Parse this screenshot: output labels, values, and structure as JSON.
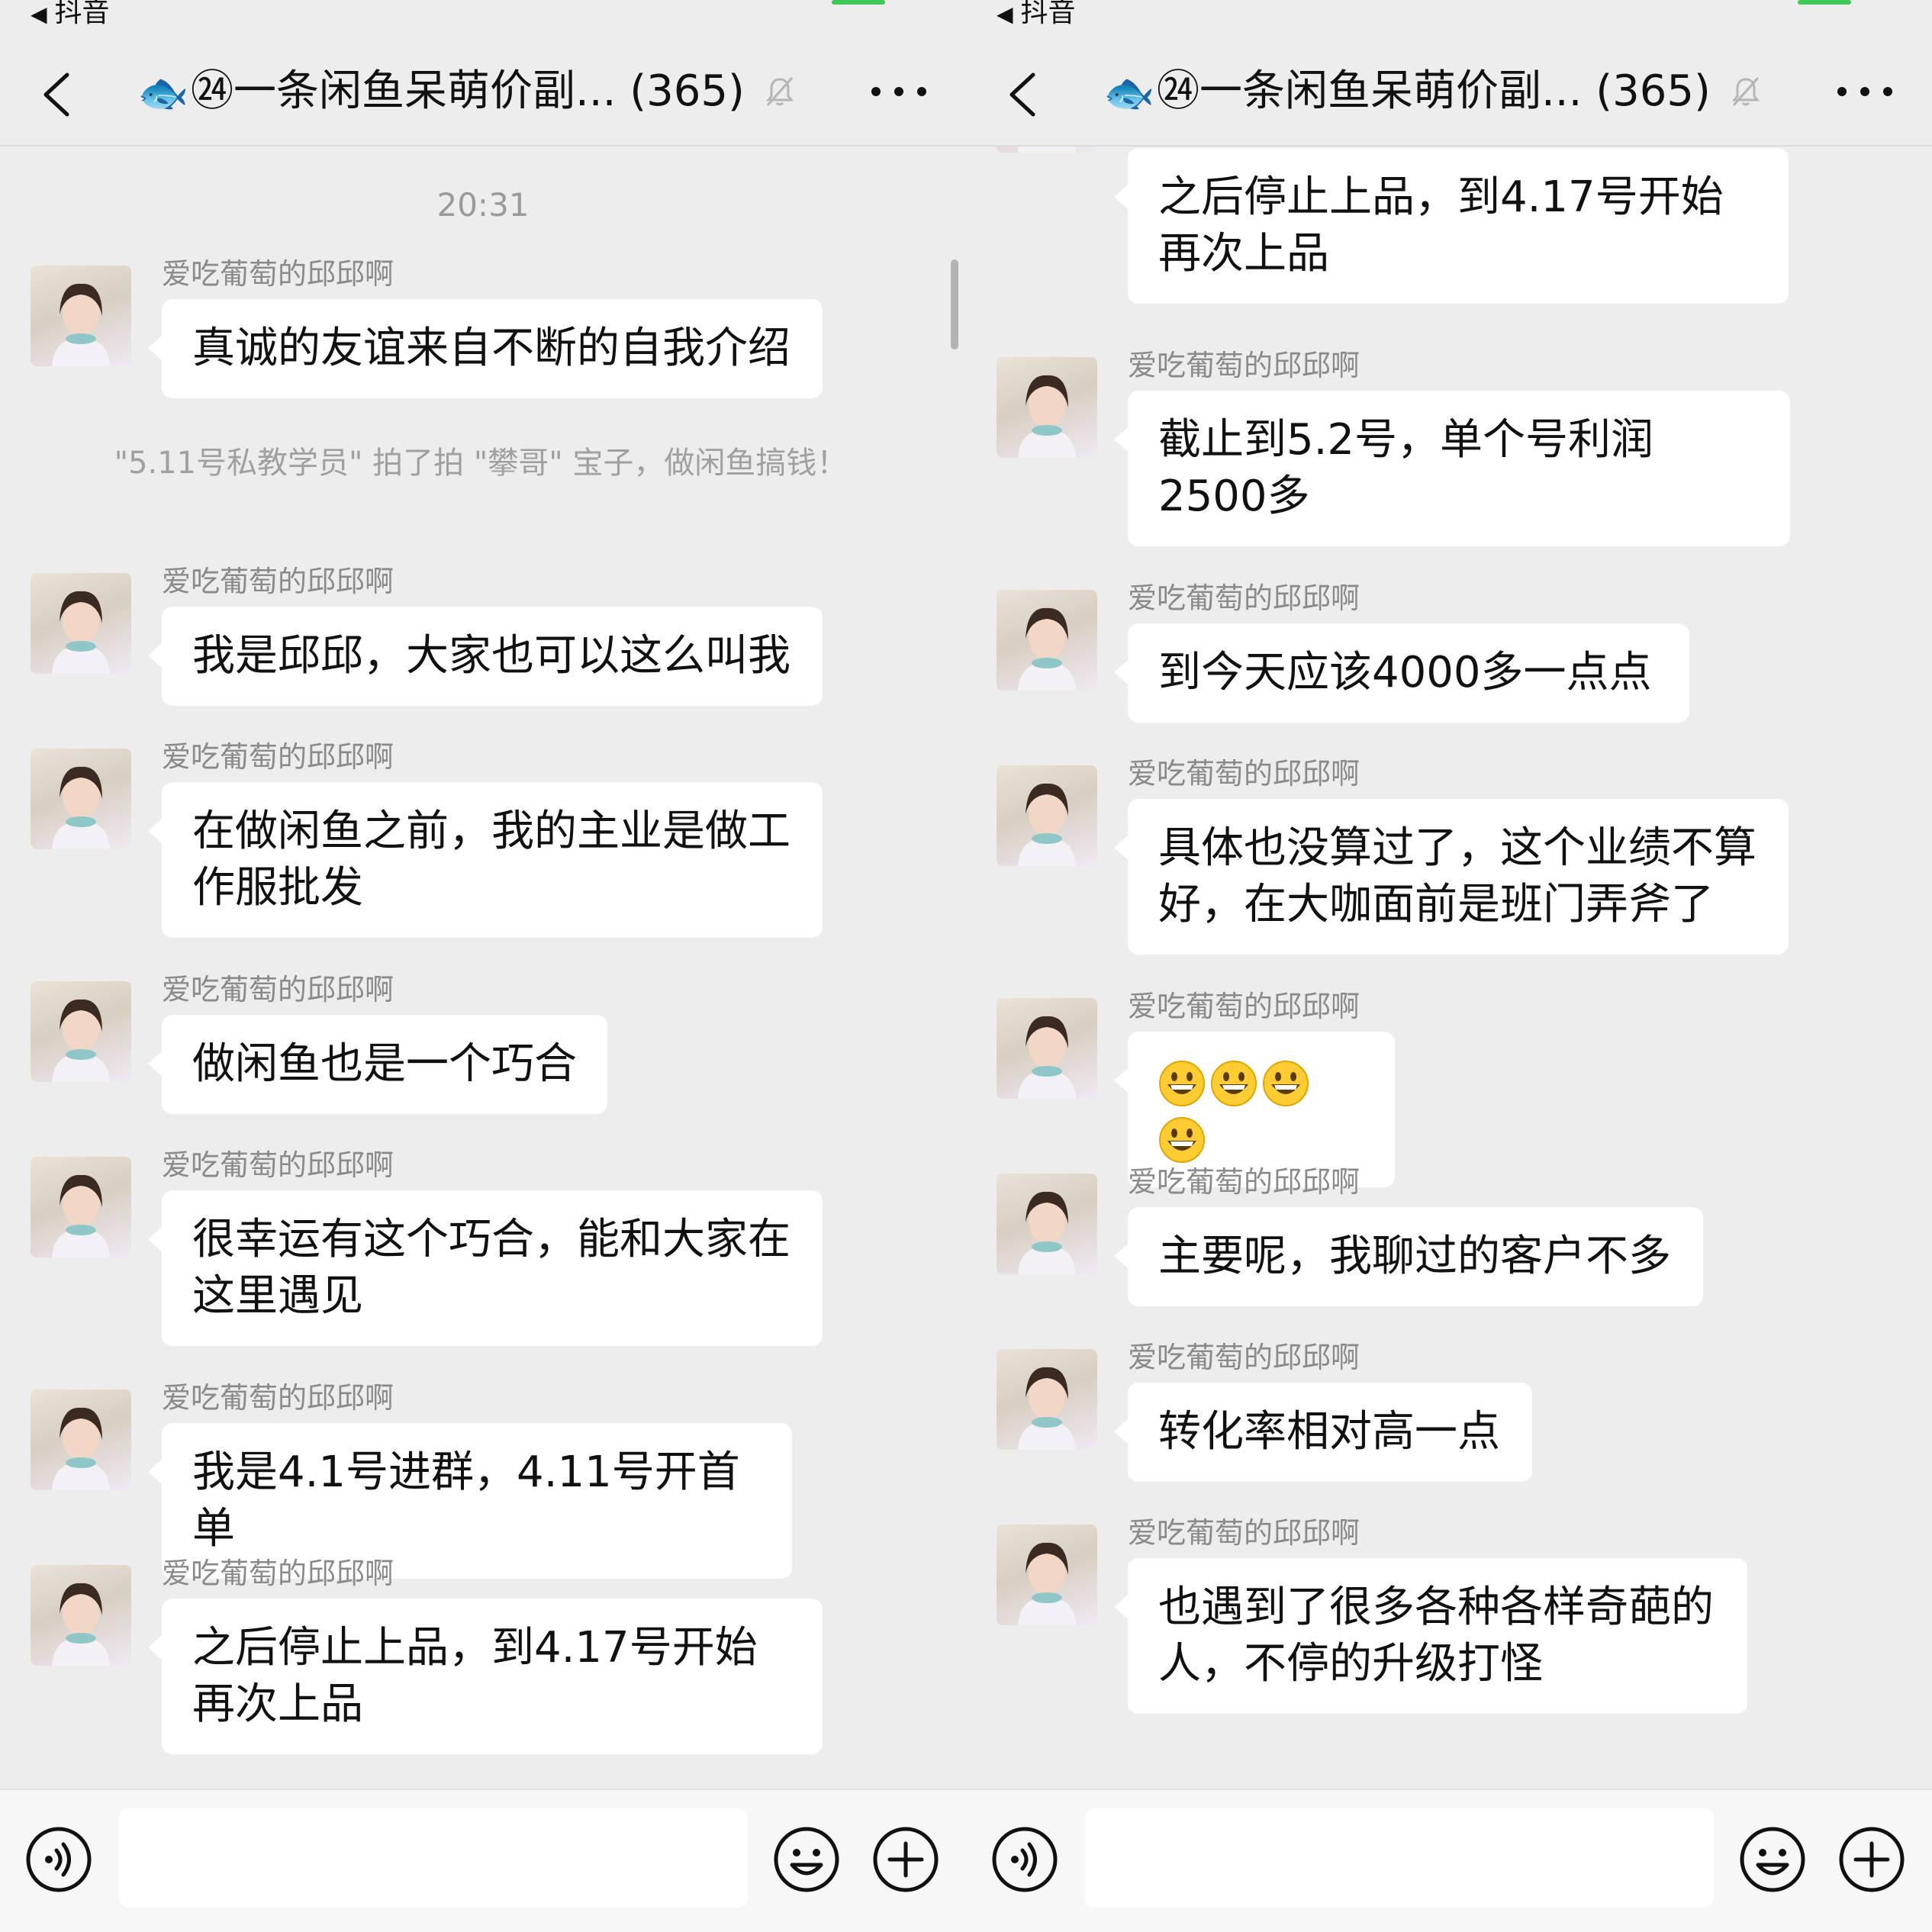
{
  "status_bar": {
    "back_app": "抖音"
  },
  "header": {
    "title": "㉔一条闲鱼呆萌价副...",
    "member_count": "(365)",
    "fish_emoji": "🐟"
  },
  "left_panel": {
    "timestamp": "20:31",
    "system_note": "\"5.11号私教学员\" 拍了拍 \"攀哥\" 宝子，做闲鱼搞钱！",
    "messages": [
      {
        "sender": "爱吃葡萄的邱邱啊",
        "text": "真诚的友谊来自不断的自我介绍"
      },
      {
        "sender": "爱吃葡萄的邱邱啊",
        "text": "我是邱邱，大家也可以这么叫我"
      },
      {
        "sender": "爱吃葡萄的邱邱啊",
        "text": "在做闲鱼之前，我的主业是做工作服批发"
      },
      {
        "sender": "爱吃葡萄的邱邱啊",
        "text": "做闲鱼也是一个巧合"
      },
      {
        "sender": "爱吃葡萄的邱邱啊",
        "text": "很幸运有这个巧合，能和大家在这里遇见"
      },
      {
        "sender": "爱吃葡萄的邱邱啊",
        "text": "我是4.1号进群，4.11号开首单"
      },
      {
        "sender": "爱吃葡萄的邱邱啊",
        "text": "之后停止上品，到4.17号开始再次上品"
      }
    ]
  },
  "right_panel": {
    "top_partial_text": "之后停止上品，到4.17号开始再次上品",
    "messages": [
      {
        "sender": "爱吃葡萄的邱邱啊",
        "text": "截止到5.2号，单个号利润2500多"
      },
      {
        "sender": "爱吃葡萄的邱邱啊",
        "text": "到今天应该4000多一点点"
      },
      {
        "sender": "爱吃葡萄的邱邱啊",
        "text": "具体也没算过了，这个业绩不算好，在大咖面前是班门弄斧了"
      },
      {
        "sender": "爱吃葡萄的邱邱啊",
        "text": "",
        "emoji_count": 4,
        "emoji": "grinning-face-icon"
      },
      {
        "sender": "爱吃葡萄的邱邱啊",
        "text": "主要呢，我聊过的客户不多"
      },
      {
        "sender": "爱吃葡萄的邱邱啊",
        "text": "转化率相对高一点"
      },
      {
        "sender": "爱吃葡萄的邱邱啊",
        "text": "也遇到了很多各种各样奇葩的人，不停的升级打怪"
      }
    ]
  },
  "colors": {
    "background": "#ededed",
    "bubble": "#ffffff",
    "sender_name": "#8a8a8a",
    "system_text": "#a0a0a0"
  },
  "icons": [
    "back-chevron-icon",
    "fish-emoji-icon",
    "mute-bell-icon",
    "more-dots-icon",
    "voice-icon",
    "emoji-face-icon",
    "plus-icon",
    "grinning-face-icon"
  ]
}
